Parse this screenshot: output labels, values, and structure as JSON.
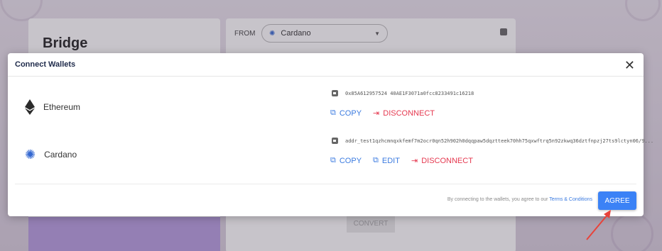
{
  "background": {
    "bridge_title": "Bridge",
    "from_label": "FROM",
    "from_select_value": "Cardano",
    "convert_label": "CONVERT"
  },
  "modal": {
    "title": "Connect Wallets",
    "wallets": [
      {
        "name": "Ethereum",
        "icon": "ethereum-icon",
        "address": "0x85A612957524 40AE1F3071a0fcc8233491c16218",
        "actions": {
          "copy": "COPY",
          "disconnect": "DISCONNECT"
        }
      },
      {
        "name": "Cardano",
        "icon": "cardano-icon",
        "address": "addr_test1qzhcmnqxkfemf7m2ocr0qn52h902h0dqqpaw5dqztteek70hh75qxwftrq5n92zkwq36dztfnpzj27ts9lctyn06/9...",
        "actions": {
          "copy": "COPY",
          "edit": "EDIT",
          "disconnect": "DISCONNECT"
        }
      }
    ],
    "footer": {
      "text": "By connecting to the wallets, you agree to our",
      "link": "Terms & Conditions",
      "agree": "AGREE"
    }
  },
  "colors": {
    "accent": "#3b82f6",
    "danger": "#e53950",
    "annotation_arrow": "#e8433a"
  }
}
